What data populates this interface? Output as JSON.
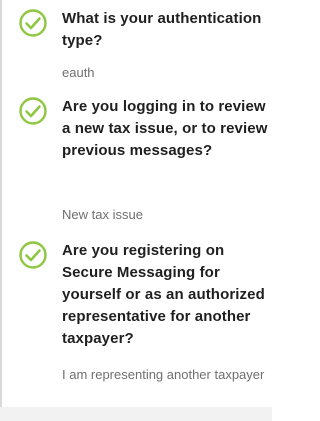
{
  "steps": [
    {
      "question": "What is your authentication type?",
      "answer": "eauth",
      "icon": "check-circle-icon"
    },
    {
      "question": "Are you logging in to review a new tax issue, or to review previous messages?",
      "answer": "New tax issue",
      "icon": "check-circle-icon"
    },
    {
      "question": "Are you registering on Secure Messaging for yourself or as an authorized representative for another taxpayer?",
      "answer": "I am representing another taxpayer",
      "icon": "check-circle-icon"
    }
  ],
  "colors": {
    "check": "#8dc63f",
    "question_text": "#1f1f1f",
    "answer_text": "#6f6f6f",
    "rule": "#d9d9d9"
  }
}
